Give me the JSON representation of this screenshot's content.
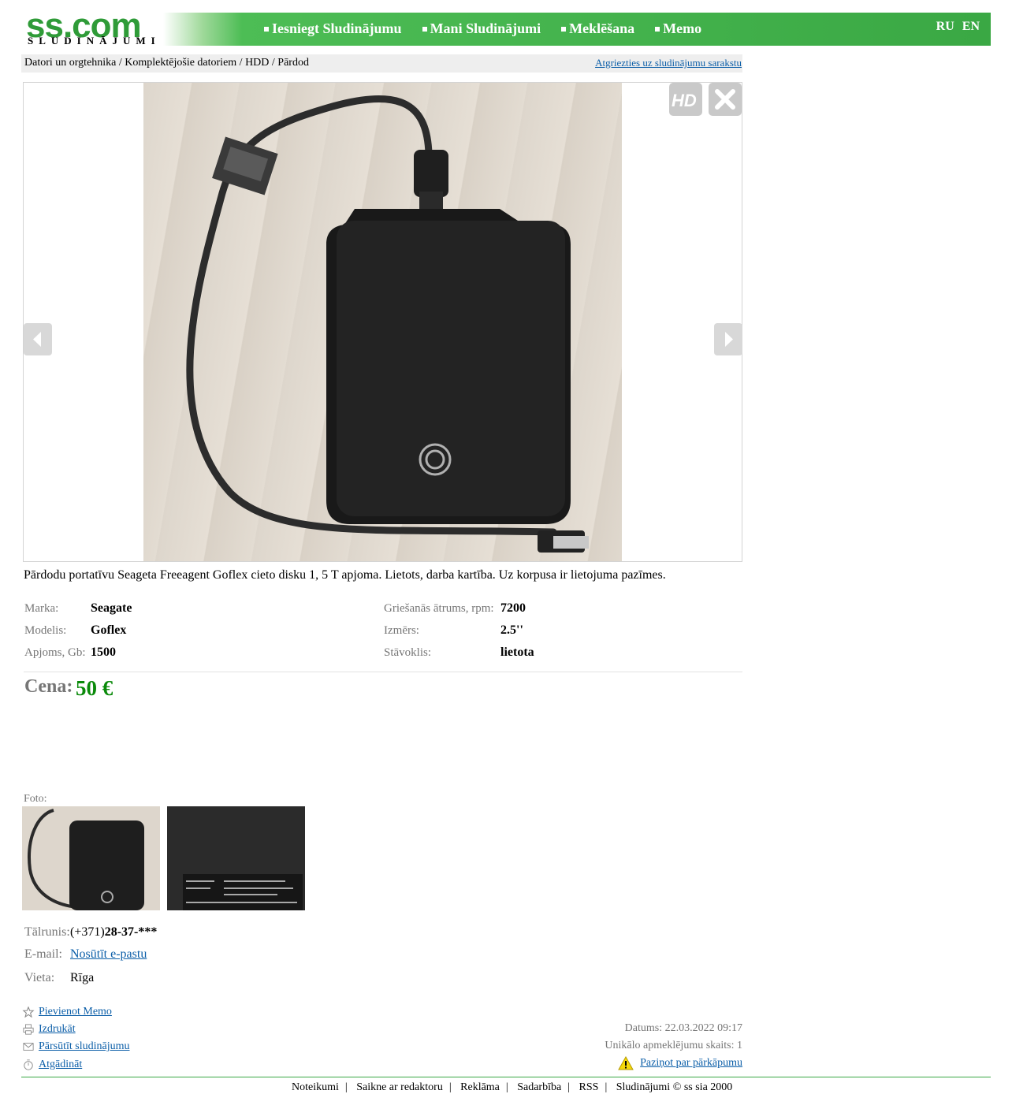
{
  "header": {
    "logo_text": "ss.com",
    "logo_sub": "SLUDINĀJUMI",
    "nav": [
      "Iesniegt Sludinājumu",
      "Mani Sludinājumi",
      "Meklēšana",
      "Memo"
    ],
    "langs": [
      "RU",
      "EN"
    ]
  },
  "breadcrumb": {
    "path": "Datori un orgtehnika / Komplektējošie datoriem / HDD / Pārdod",
    "back_link": "Atgriezties uz sludinājumu sarakstu"
  },
  "viewer": {
    "hd_icon": "hd-icon",
    "close_icon": "close-icon",
    "prev_icon": "arrow-left-icon",
    "next_icon": "arrow-right-icon"
  },
  "description": "Pārdodu portatīvu Seageta Freeagent Goflex cieto disku 1, 5 T apjoma. Lietots, darba kartība. Uz korpusa ir lietojuma pazīmes.",
  "specs": {
    "left": [
      {
        "label": "Marka:",
        "value": "Seagate"
      },
      {
        "label": "Modelis:",
        "value": "Goflex"
      },
      {
        "label": "Apjoms, Gb:",
        "value": "1500"
      }
    ],
    "right": [
      {
        "label": "Griešanās ātrums, rpm:",
        "value": "7200"
      },
      {
        "label": "Izmērs:",
        "value": "2.5''"
      },
      {
        "label": "Stāvoklis:",
        "value": "lietota"
      }
    ]
  },
  "price": {
    "label": "Cena:",
    "value": "50 €"
  },
  "photos": {
    "label": "Foto:"
  },
  "contacts": {
    "phone_label": "Tālrunis:",
    "phone_prefix": "(+371)",
    "phone_number": "28-37-***",
    "email_label": "E-mail:",
    "email_link": "Nosūtīt e-pastu",
    "place_label": "Vieta:",
    "place_value": "Rīga"
  },
  "actions": [
    "Pievienot Memo",
    "Izdrukāt",
    "Pārsūtīt sludinājumu",
    "Atgādināt"
  ],
  "meta": {
    "date": "Datums: 22.03.2022 09:17",
    "visits": "Unikālo apmeklējumu skaits: 1",
    "report": "Paziņot par pārkāpumu"
  },
  "footer": [
    "Noteikumi",
    "Saikne ar redaktoru",
    "Reklāma",
    "Sadarbība",
    "RSS",
    "Sludinājumi © ss sia 2000"
  ]
}
